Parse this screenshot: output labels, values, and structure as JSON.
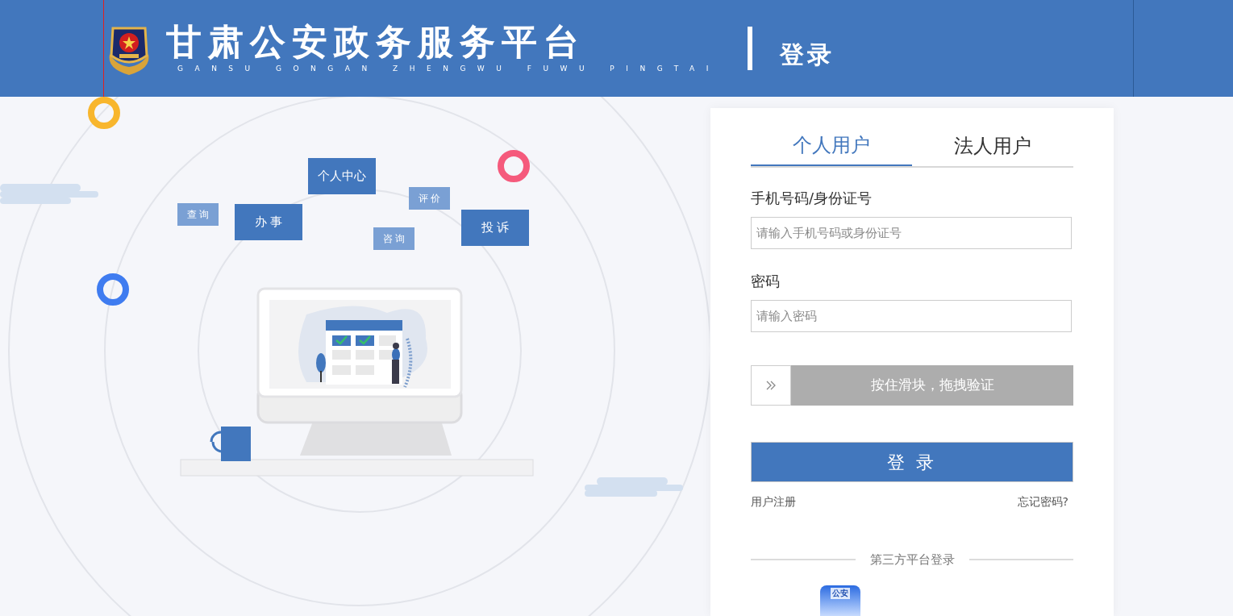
{
  "header": {
    "title": "甘肃公安政务服务平台",
    "subtitle": "GANSU GONGAN ZHENGWU FUWU PINGTAI",
    "page": "登录"
  },
  "illustration": {
    "tags": [
      {
        "label": "个人中心",
        "kind": "strong"
      },
      {
        "label": "查 询",
        "kind": "light"
      },
      {
        "label": "办 事",
        "kind": "strong"
      },
      {
        "label": "评 价",
        "kind": "light"
      },
      {
        "label": "咨 询",
        "kind": "light"
      },
      {
        "label": "投 诉",
        "kind": "strong"
      }
    ]
  },
  "login": {
    "tabs": [
      {
        "label": "个人用户",
        "selected": true
      },
      {
        "label": "法人用户",
        "selected": false
      }
    ],
    "fields": [
      {
        "label": "手机号码/身份证号",
        "placeholder": "请输入手机号码或身份证号"
      },
      {
        "label": "密码",
        "placeholder": "请输入密码"
      }
    ],
    "slider": {
      "text": "按住滑块，拖拽验证"
    },
    "submit": "登 录",
    "links": [
      "用户注册",
      "忘记密码?"
    ],
    "third_party": {
      "title": "第三方平台登录",
      "providers": [
        {
          "badge": "公安"
        }
      ]
    }
  }
}
